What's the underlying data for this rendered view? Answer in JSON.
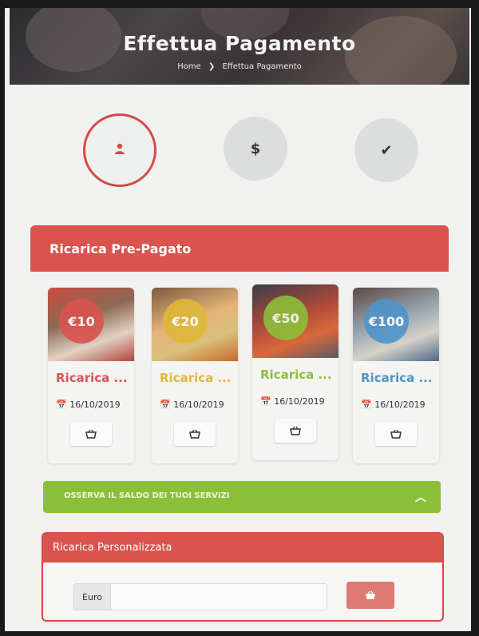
{
  "page": {
    "title": "Effettua Pagamento"
  },
  "breadcrumb": {
    "home": "Home",
    "separator": "❯",
    "current": "Effettua Pagamento"
  },
  "steps": [
    {
      "icon": "user-icon",
      "symbol": "👤",
      "active": true
    },
    {
      "icon": "dollar-icon",
      "symbol": "$",
      "active": false
    },
    {
      "icon": "check-icon",
      "symbol": "✔",
      "active": false
    }
  ],
  "section": {
    "title": "Ricarica Pre-Pagato"
  },
  "cards": [
    {
      "price": "€10",
      "title": "Ricarica ...",
      "date": "16/10/2019",
      "color": "#d8544d"
    },
    {
      "price": "€20",
      "title": "Ricarica ...",
      "date": "16/10/2019",
      "color": "#e0b73a"
    },
    {
      "price": "€50",
      "title": "Ricarica ...",
      "date": "16/10/2019",
      "color": "#8cbf38"
    },
    {
      "price": "€100",
      "title": "Ricarica ...",
      "date": "16/10/2019",
      "color": "#4f94c8"
    }
  ],
  "balance_bar": {
    "label": "Osserva il saldo dei tuoi servizi"
  },
  "custom": {
    "title": "Ricarica Personalizzata",
    "addon": "Euro",
    "value": ""
  },
  "colors": {
    "accent": "#d8544d",
    "green": "#8cbf38"
  }
}
